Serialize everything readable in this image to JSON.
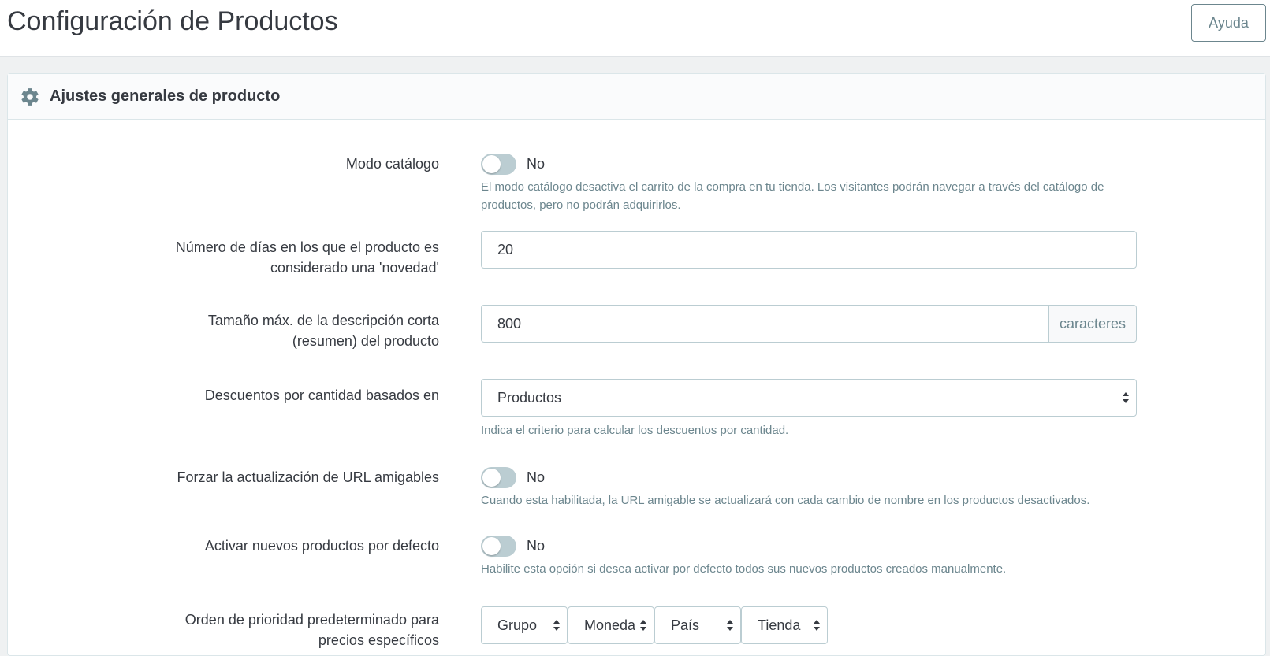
{
  "header": {
    "title": "Configuración de Productos",
    "help_label": "Ayuda"
  },
  "card": {
    "title": "Ajustes generales de producto",
    "icon": "gear-icon"
  },
  "fields": {
    "catalog_mode": {
      "label": "Modo catálogo",
      "value": "No",
      "hint": "El modo catálogo desactiva el carrito de la compra en tu tienda. Los visitantes podrán navegar a través del catálogo de productos, pero no podrán adquirirlos."
    },
    "new_days": {
      "label": "Número de días en los que el producto es considerado una 'novedad'",
      "value": "20"
    },
    "short_desc": {
      "label": "Tamaño máx. de la descripción corta (resumen) del producto",
      "value": "800",
      "addon": "caracteres"
    },
    "qty_discount": {
      "label": "Descuentos por cantidad basados en",
      "value": "Productos",
      "hint": "Indica el criterio para calcular los descuentos por cantidad."
    },
    "force_url": {
      "label": "Forzar la actualización de URL amigables",
      "value": "No",
      "hint": "Cuando esta habilitada, la URL amigable se actualizará con cada cambio de nombre en los productos desactivados."
    },
    "activate_new": {
      "label": "Activar nuevos productos por defecto",
      "value": "No",
      "hint": "Habilite esta opción si desea activar por defecto todos sus nuevos productos creados manualmente."
    },
    "priority": {
      "label": "Orden de prioridad predeterminado para precios específicos",
      "options": [
        "Grupo",
        "Moneda",
        "País",
        "Tienda"
      ]
    }
  },
  "colors": {
    "switch_off": "#bbcdd2",
    "hint": "#6c868e",
    "text": "#363a41"
  }
}
